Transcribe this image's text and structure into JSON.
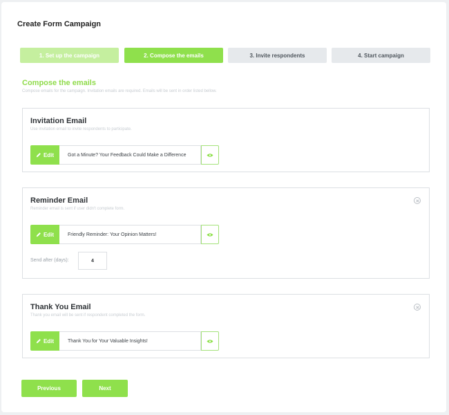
{
  "page": {
    "title": "Create Form Campaign"
  },
  "steps": [
    {
      "label": "1. Set up the campaign"
    },
    {
      "label": "2. Compose the emails"
    },
    {
      "label": "3. Invite respondents"
    },
    {
      "label": "4. Start campaign"
    }
  ],
  "section": {
    "title": "Compose the emails",
    "subtitle": "Compose emails for the campaign. Invitation emails are required. Emails will be sent in order listed bellow."
  },
  "emails": [
    {
      "title": "Invitation Email",
      "description": "Use invitation email to invite respondents to participate.",
      "edit_label": "Edit",
      "subject": "Got a Minute? Your Feedback Could Make a Difference"
    },
    {
      "title": "Reminder Email",
      "description": "Reminder email is sent if user didn't complete form.",
      "edit_label": "Edit",
      "subject": "Friendly Reminder: Your Opinion Matters!",
      "send_after_label": "Send after (days):",
      "send_after_value": "4"
    },
    {
      "title": "Thank You Email",
      "description": "Thank you email will be sent if respondent completed the form.",
      "edit_label": "Edit",
      "subject": "Thank You for Your Valuable Insights!"
    }
  ],
  "nav": {
    "previous_label": "Previous",
    "next_label": "Next"
  },
  "colors": {
    "accent": "#8fe04c",
    "accent_light": "#c5ef9f",
    "inactive_step": "#e6e9ec"
  },
  "icons": {
    "edit": "pencil-icon",
    "preview": "eye-icon",
    "remove": "close-icon"
  }
}
